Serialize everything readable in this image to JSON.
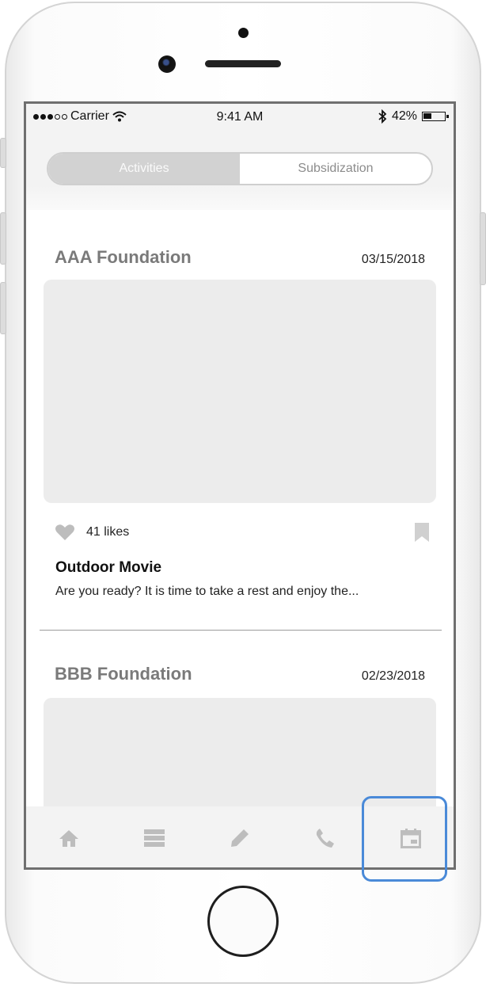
{
  "status_bar": {
    "carrier": "Carrier",
    "time": "9:41 AM",
    "battery": "42%",
    "battery_level": 0.42,
    "signal_bars_filled": 3,
    "signal_bars_total": 5
  },
  "tabs": {
    "activities": "Activities",
    "subsidization": "Subsidization",
    "selected": "Activities"
  },
  "posts": [
    {
      "organization": "AAA Foundation",
      "date": "03/15/2018",
      "likes": "41 likes",
      "title": "Outdoor Movie",
      "excerpt": "Are you ready? It is time to take a rest and enjoy the..."
    },
    {
      "organization": "BBB Foundation",
      "date": "02/23/2018"
    }
  ],
  "tab_bar": {
    "items": [
      "home-icon",
      "list-icon",
      "pencil-icon",
      "phone-icon",
      "calendar-icon"
    ],
    "highlighted": "calendar-icon"
  },
  "colors": {
    "highlight": "#4a8ad8",
    "segment_active": "#d2d2d2",
    "icon_gray": "#bdbdbd"
  }
}
